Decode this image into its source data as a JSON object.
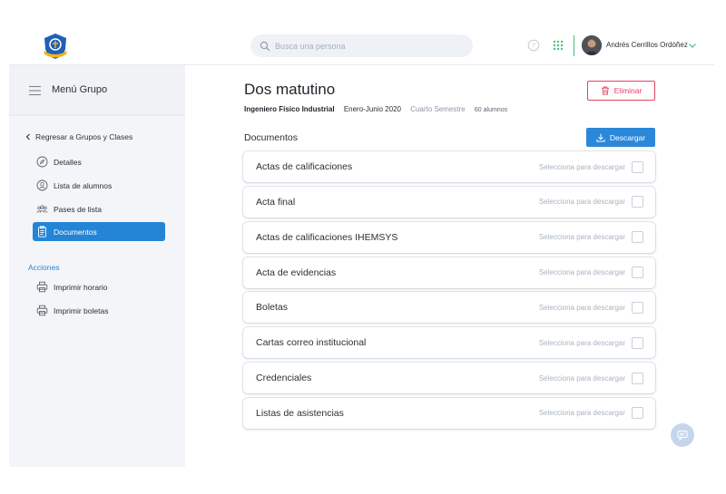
{
  "header": {
    "search_placeholder": "Busca una persona",
    "user_name": "Andrés Cerrillos Ordóñez"
  },
  "sidebar": {
    "title": "Menú Grupo",
    "back_label": "Regresar a Grupos y Clases",
    "items": [
      {
        "label": "Detalles",
        "icon": "compass-icon"
      },
      {
        "label": "Lista de alumnos",
        "icon": "user-circle-icon"
      },
      {
        "label": "Pases de lista",
        "icon": "group-icon"
      },
      {
        "label": "Documentos",
        "icon": "clipboard-icon",
        "active": true
      }
    ],
    "actions_label": "Acciones",
    "actions": [
      {
        "label": "Imprimir horario",
        "icon": "printer-icon"
      },
      {
        "label": "Imprimir boletas",
        "icon": "printer-icon"
      }
    ]
  },
  "main": {
    "title": "Dos matutino",
    "career": "Ingeniero Físico Industrial",
    "period": "Enero-Junio 2020",
    "semester": "Cuarto Semestre",
    "students": "60 alumnos",
    "delete_label": "Eliminar",
    "documents_label": "Documentos",
    "download_label": "Descargar",
    "select_hint": "Selecciona para descargar",
    "documents": [
      "Actas de calificaciones",
      "Acta final",
      "Actas de calificaciones IHEMSYS",
      "Acta de evidencias",
      "Boletas",
      "Cartas correo institucional",
      "Credenciales",
      "Listas de asistencias"
    ]
  },
  "colors": {
    "accent": "#2484d6",
    "danger": "#e0445e",
    "sidebar_bg": "#f3f5f8"
  }
}
